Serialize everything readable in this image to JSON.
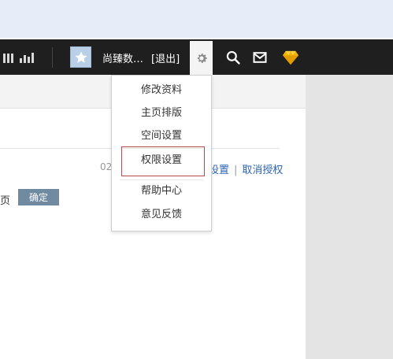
{
  "topbar": {
    "username": "尚臻数…",
    "logout_label": "[退出]",
    "icons": [
      "pause-bars-icon",
      "signal-bars-icon",
      "gear-icon",
      "search-icon",
      "mail-icon",
      "diamond-icon"
    ],
    "colors": {
      "bar_bg": "#1f1f1f",
      "diamond": "#f5b400"
    }
  },
  "dropdown": {
    "items": [
      {
        "label": "修改资料"
      },
      {
        "label": "主页排版"
      },
      {
        "label": "空间设置"
      },
      {
        "label": "权限设置"
      },
      {
        "label": "帮助中心"
      },
      {
        "label": "意见反馈"
      }
    ],
    "highlight_color": "#b54a4a"
  },
  "main": {
    "date_fragment": "02",
    "links": {
      "settings_fragment": "设置",
      "cancel_auth": "取消授权"
    },
    "page_fragment": "页",
    "confirm_label": "确定"
  }
}
